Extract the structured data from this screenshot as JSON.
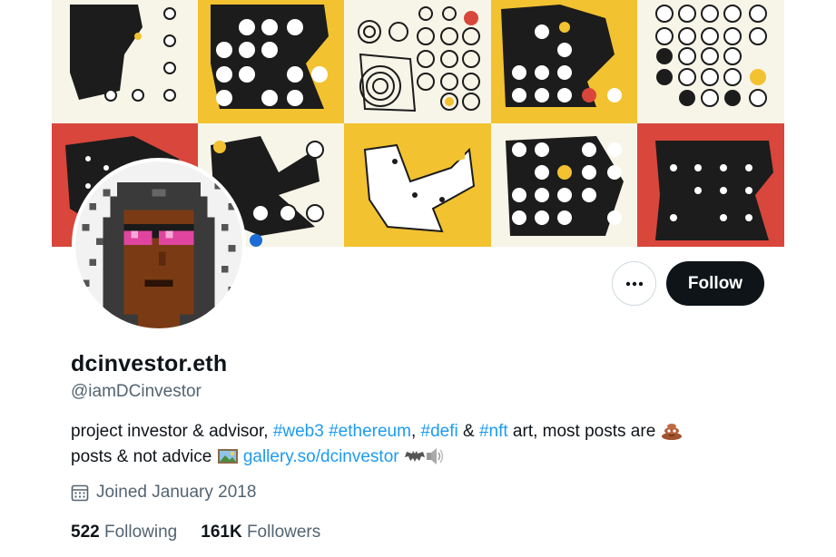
{
  "colors": {
    "brand_text": "#0f1419",
    "secondary_text": "#536471",
    "link": "#1d9bf0",
    "banner_yellow": "#f2c230",
    "banner_red": "#d9463b",
    "banner_cream": "#f7f5e8",
    "banner_black": "#1c1c1c"
  },
  "profile": {
    "display_name": "dcinvestor.eth",
    "handle": "@iamDCinvestor",
    "avatar_icon": "pixel-punk-avatar",
    "banner_icon": "generative-art-grid-banner"
  },
  "actions": {
    "more_icon": "ellipsis-icon",
    "follow_label": "Follow"
  },
  "bio": {
    "part1": "project investor & advisor, ",
    "tag_web3": "#web3",
    "space1": " ",
    "tag_ethereum": "#ethereum",
    "comma1": ", ",
    "tag_defi": "#defi",
    "amp": " & ",
    "tag_nft": "#nft",
    "part2": " art, most posts are ",
    "emoji1": "poop-emoji",
    "part3": " posts & not advice ",
    "emoji2": "framed-picture-emoji",
    "link": "gallery.so/dcinvestor",
    "emoji3": "bat-emoji",
    "emoji4": "speaker-emoji"
  },
  "meta": {
    "joined_icon": "calendar-icon",
    "joined_text": "Joined January 2018"
  },
  "stats": {
    "following_count": "522",
    "following_label": "Following",
    "followers_count": "161K",
    "followers_label": "Followers"
  }
}
